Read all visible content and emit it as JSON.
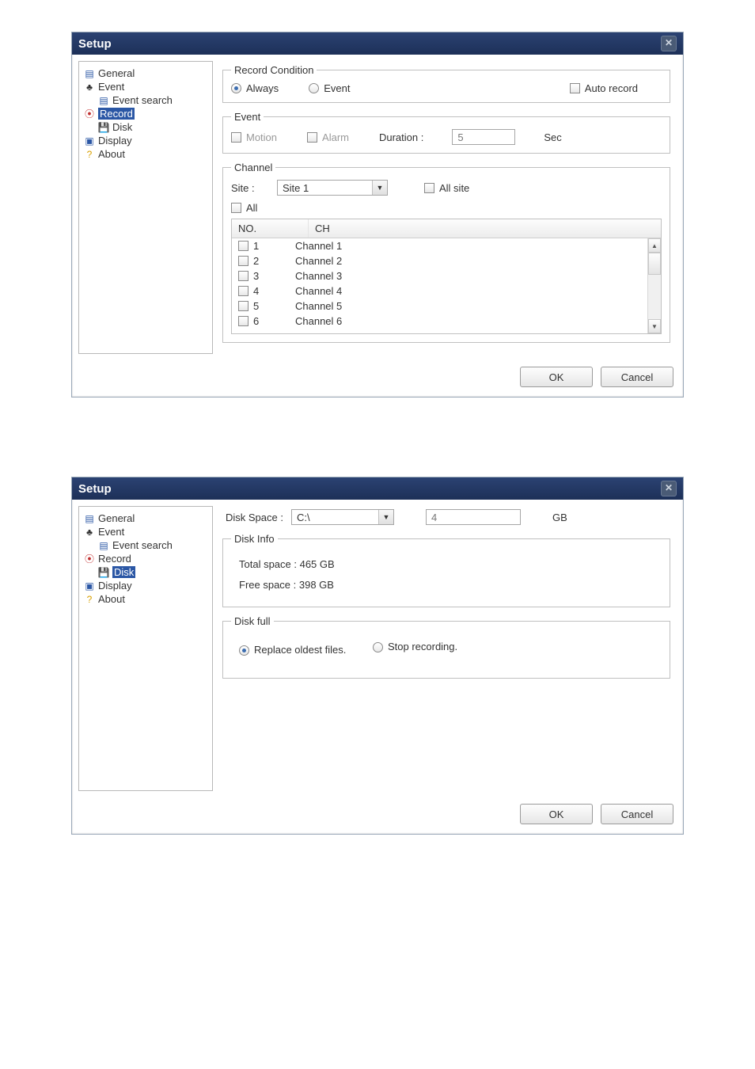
{
  "dialog1": {
    "title": "Setup",
    "sidebar": [
      {
        "label": "General",
        "icon": "page-icon"
      },
      {
        "label": "Event",
        "icon": "bell-icon"
      },
      {
        "label": "Event search",
        "icon": "search-event-icon",
        "indent": true
      },
      {
        "label": "Record",
        "icon": "record-icon",
        "selected": true
      },
      {
        "label": "Disk",
        "icon": "disk-icon",
        "indent": true
      },
      {
        "label": "Display",
        "icon": "display-icon"
      },
      {
        "label": "About",
        "icon": "help-icon"
      }
    ],
    "recordCondition": {
      "legend": "Record Condition",
      "always": "Always",
      "event": "Event",
      "autoRecord": "Auto record"
    },
    "event": {
      "legend": "Event",
      "motion": "Motion",
      "alarm": "Alarm",
      "durationLabel": "Duration :",
      "durationValue": "5",
      "durationUnit": "Sec"
    },
    "channel": {
      "legend": "Channel",
      "siteLabel": "Site :",
      "siteValue": "Site 1",
      "allSite": "All site",
      "all": "All",
      "cols": {
        "no": "NO.",
        "ch": "CH"
      },
      "rows": [
        {
          "no": "1",
          "ch": "Channel 1"
        },
        {
          "no": "2",
          "ch": "Channel 2"
        },
        {
          "no": "3",
          "ch": "Channel 3"
        },
        {
          "no": "4",
          "ch": "Channel 4"
        },
        {
          "no": "5",
          "ch": "Channel 5"
        },
        {
          "no": "6",
          "ch": "Channel 6"
        }
      ]
    },
    "buttons": {
      "ok": "OK",
      "cancel": "Cancel"
    }
  },
  "dialog2": {
    "title": "Setup",
    "sidebar": [
      {
        "label": "General",
        "icon": "page-icon"
      },
      {
        "label": "Event",
        "icon": "bell-icon"
      },
      {
        "label": "Event search",
        "icon": "search-event-icon",
        "indent": true
      },
      {
        "label": "Record",
        "icon": "record-icon"
      },
      {
        "label": "Disk",
        "icon": "disk-icon",
        "indent": true,
        "selected": true
      },
      {
        "label": "Display",
        "icon": "display-icon"
      },
      {
        "label": "About",
        "icon": "help-icon"
      }
    ],
    "disk": {
      "spaceLabel": "Disk Space :",
      "drive": "C:\\",
      "sizeValue": "4",
      "sizeUnit": "GB",
      "infoLegend": "Disk Info",
      "total": "Total space : 465 GB",
      "free": "Free space : 398 GB",
      "fullLegend": "Disk full",
      "replace": "Replace oldest files.",
      "stop": "Stop recording."
    },
    "buttons": {
      "ok": "OK",
      "cancel": "Cancel"
    }
  },
  "icons": {
    "page-icon": "▤",
    "bell-icon": "♣",
    "search-event-icon": "▤",
    "record-icon": "⦿",
    "disk-icon": "💾",
    "display-icon": "▣",
    "help-icon": "?"
  },
  "iconColors": {
    "page-icon": "#2b57a5",
    "bell-icon": "#333",
    "search-event-icon": "#2b57a5",
    "record-icon": "#c03030",
    "disk-icon": "#c03030",
    "display-icon": "#2b57a5",
    "help-icon": "#d8a000"
  }
}
